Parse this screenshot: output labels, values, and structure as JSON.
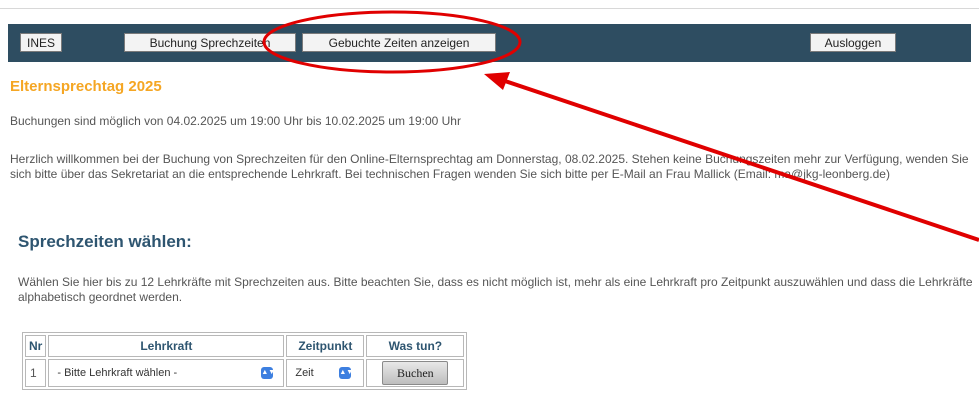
{
  "nav": {
    "ines_label": "INES",
    "booking_label": "Buchung Sprechzeiten",
    "booked_label": "Gebuchte Zeiten anzeigen",
    "logout_label": "Ausloggen"
  },
  "page": {
    "title": "Elternsprechtag 2025",
    "booking_window": "Buchungen sind möglich von 04.02.2025 um 19:00 Uhr bis 10.02.2025 um 19:00 Uhr",
    "welcome_text": "Herzlich willkommen bei der Buchung von Sprechzeiten für den Online-Elternsprechtag am Donnerstag, 08.02.2025. Stehen keine Buchungszeiten mehr zur Verfügung, wenden Sie sich bitte über das Sekretariat an die entsprechende Lehrkraft. Bei technischen Fragen wenden Sie sich bitte per E-Mail an Frau Mallick (Email: ma@jkg-leonberg.de)"
  },
  "selection": {
    "heading": "Sprechzeiten wählen:",
    "instructions": "Wählen Sie hier bis zu 12 Lehrkräfte mit Sprechzeiten aus. Bitte beachten Sie, dass es nicht möglich ist, mehr als eine Lehrkraft pro Zeitpunkt auszuwählen und dass die Lehrkräfte alphabetisch geordnet werden."
  },
  "table": {
    "headers": [
      "Nr",
      "Lehrkraft",
      "Zeitpunkt",
      "Was tun?"
    ],
    "rows": [
      {
        "nr": "1",
        "teacher_select": "- Bitte Lehrkraft wählen -",
        "time_select": "Zeit",
        "action": "Buchen"
      }
    ]
  },
  "colors": {
    "navbar": "#2e4d61",
    "title": "#f5a623",
    "heading": "#2e5570",
    "annotation": "#e00000"
  },
  "annotation": {
    "shape": "ellipse-around-booked-times-button",
    "arrow": "pointing-to-booked-times-button"
  }
}
